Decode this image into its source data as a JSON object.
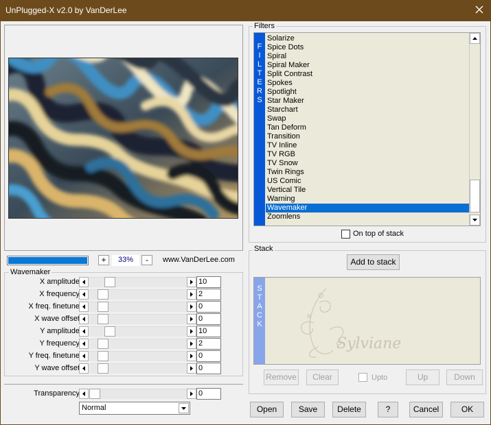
{
  "window": {
    "title": "UnPlugged-X v2.0 by VanDerLee"
  },
  "preview": {
    "zoom": "33%",
    "zoom_minus": "-",
    "zoom_plus": "+",
    "website": "www.VanDerLee.com",
    "progress_fraction": 1.0
  },
  "params": {
    "group_label": "Wavemaker",
    "rows": [
      {
        "label": "X amplitude",
        "value": "10"
      },
      {
        "label": "X frequency",
        "value": "2"
      },
      {
        "label": "X freq. finetune",
        "value": "0"
      },
      {
        "label": "X wave offset",
        "value": "0"
      },
      {
        "label": "Y amplitude",
        "value": "10"
      },
      {
        "label": "Y frequency",
        "value": "2"
      },
      {
        "label": "Y freq. finetune",
        "value": "0"
      },
      {
        "label": "Y wave offset",
        "value": "0"
      }
    ],
    "transparency": {
      "label": "Transparency",
      "value": "0"
    },
    "blend_mode": "Normal"
  },
  "filters": {
    "group_label": "Filters",
    "side_letters": [
      "F",
      "I",
      "L",
      "T",
      "E",
      "R",
      "S"
    ],
    "items": [
      "Solarize",
      "Spice Dots",
      "Spiral",
      "Spiral Maker",
      "Split Contrast",
      "Spokes",
      "Spotlight",
      "Star Maker",
      "Starchart",
      "Swap",
      "Tan Deform",
      "Transition",
      "TV Inline",
      "TV RGB",
      "TV Snow",
      "Twin Rings",
      "US Comic",
      "Vertical Tile",
      "Warning",
      "Wavemaker",
      "Zoomlens"
    ],
    "selected": "Wavemaker",
    "on_top_label": "On top of stack"
  },
  "stack": {
    "group_label": "Stack",
    "add_label": "Add to stack",
    "side_letters": [
      "S",
      "T",
      "A",
      "C",
      "K"
    ],
    "watermark_text": "Sylviane",
    "remove_label": "Remove",
    "clear_label": "Clear",
    "upto_label": "Upto",
    "up_label": "Up",
    "down_label": "Down"
  },
  "buttons": {
    "open": "Open",
    "save": "Save",
    "delete": "Delete",
    "help": "?",
    "cancel": "Cancel",
    "ok": "OK"
  },
  "colors": {
    "titlebar": "#6d4a1c",
    "selection": "#0a6fd2",
    "filters_bar": "#0758d9",
    "stack_bar": "#88a4ea"
  }
}
